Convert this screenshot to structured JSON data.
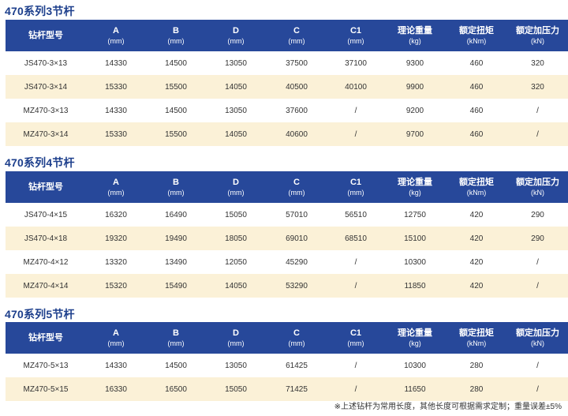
{
  "columns": [
    {
      "label": "钻杆型号",
      "unit": ""
    },
    {
      "label": "A",
      "unit": "(mm)"
    },
    {
      "label": "B",
      "unit": "(mm)"
    },
    {
      "label": "D",
      "unit": "(mm)"
    },
    {
      "label": "C",
      "unit": "(mm)"
    },
    {
      "label": "C1",
      "unit": "(mm)"
    },
    {
      "label": "理论重量",
      "unit": "(kg)"
    },
    {
      "label": "额定扭矩",
      "unit": "(kNm)"
    },
    {
      "label": "额定加压力",
      "unit": "(kN)"
    }
  ],
  "sections": [
    {
      "title": "470系列3节杆",
      "rows": [
        [
          "JS470-3×13",
          "14330",
          "14500",
          "13050",
          "37500",
          "37100",
          "9300",
          "460",
          "320"
        ],
        [
          "JS470-3×14",
          "15330",
          "15500",
          "14050",
          "40500",
          "40100",
          "9900",
          "460",
          "320"
        ],
        [
          "MZ470-3×13",
          "14330",
          "14500",
          "13050",
          "37600",
          "/",
          "9200",
          "460",
          "/"
        ],
        [
          "MZ470-3×14",
          "15330",
          "15500",
          "14050",
          "40600",
          "/",
          "9700",
          "460",
          "/"
        ]
      ]
    },
    {
      "title": "470系列4节杆",
      "rows": [
        [
          "JS470-4×15",
          "16320",
          "16490",
          "15050",
          "57010",
          "56510",
          "12750",
          "420",
          "290"
        ],
        [
          "JS470-4×18",
          "19320",
          "19490",
          "18050",
          "69010",
          "68510",
          "15100",
          "420",
          "290"
        ],
        [
          "MZ470-4×12",
          "13320",
          "13490",
          "12050",
          "45290",
          "/",
          "10300",
          "420",
          "/"
        ],
        [
          "MZ470-4×14",
          "15320",
          "15490",
          "14050",
          "53290",
          "/",
          "11850",
          "420",
          "/"
        ]
      ]
    },
    {
      "title": "470系列5节杆",
      "rows": [
        [
          "MZ470-5×13",
          "14330",
          "14500",
          "13050",
          "61425",
          "/",
          "10300",
          "280",
          "/"
        ],
        [
          "MZ470-5×15",
          "16330",
          "16500",
          "15050",
          "71425",
          "/",
          "11650",
          "280",
          "/"
        ]
      ]
    }
  ],
  "footnote": "※上述钻杆为常用长度，其他长度可根据需求定制；重量误差±5%"
}
